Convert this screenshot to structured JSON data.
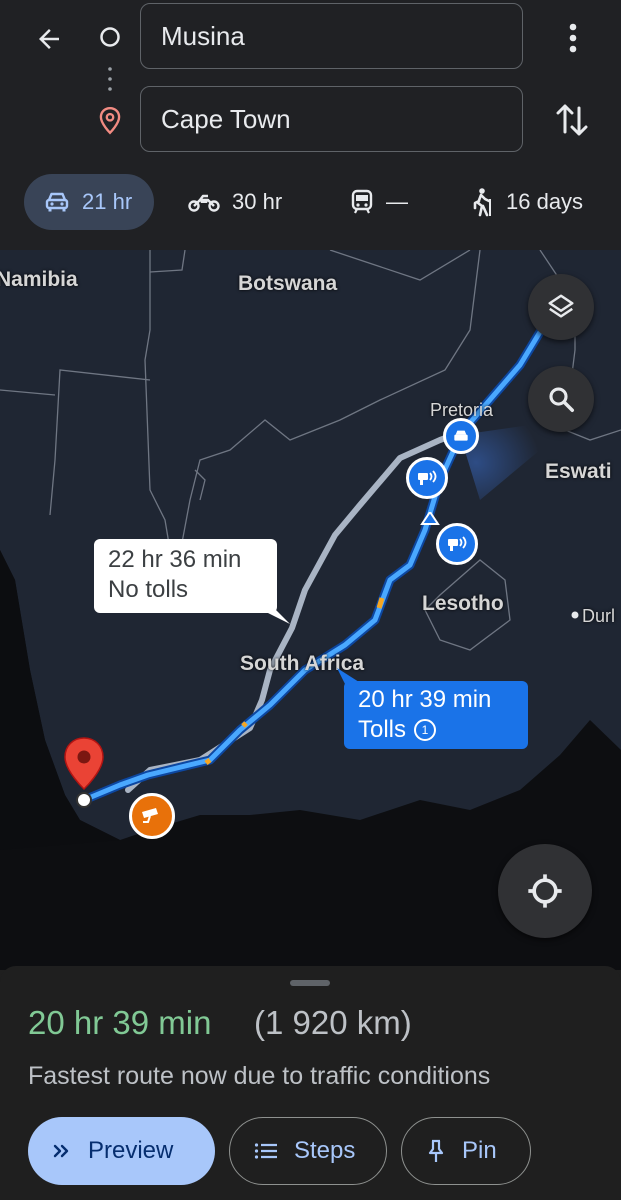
{
  "header": {
    "origin": "Musina",
    "destination": "Cape Town"
  },
  "modes": [
    {
      "icon": "car-icon",
      "label": "21 hr",
      "selected": true
    },
    {
      "icon": "motorcycle-icon",
      "label": "30 hr",
      "selected": false
    },
    {
      "icon": "train-icon",
      "label": "—",
      "selected": false
    },
    {
      "icon": "walking-icon",
      "label": "16 days",
      "selected": false
    }
  ],
  "map": {
    "labels": {
      "namibia": "Namibia",
      "botswana": "Botswana",
      "pretoria": "Pretoria",
      "eswatini": "Eswati",
      "lesotho": "Lesotho",
      "south_africa": "South Africa",
      "durban": "Durl"
    },
    "alt_route": {
      "time": "22 hr 36 min",
      "note": "No tolls"
    },
    "main_route": {
      "time": "20 hr 39 min",
      "note": "Tolls",
      "toll_count": "1"
    },
    "route_color": "#4aa8ff",
    "alt_route_color": "#a9b4c4"
  },
  "summary": {
    "duration": "20 hr 39 min",
    "distance": "(1 920 km)",
    "description": "Fastest route now due to traffic conditions",
    "duration_color": "#81c995"
  },
  "actions": {
    "preview": "Preview",
    "steps": "Steps",
    "pin": "Pin"
  }
}
